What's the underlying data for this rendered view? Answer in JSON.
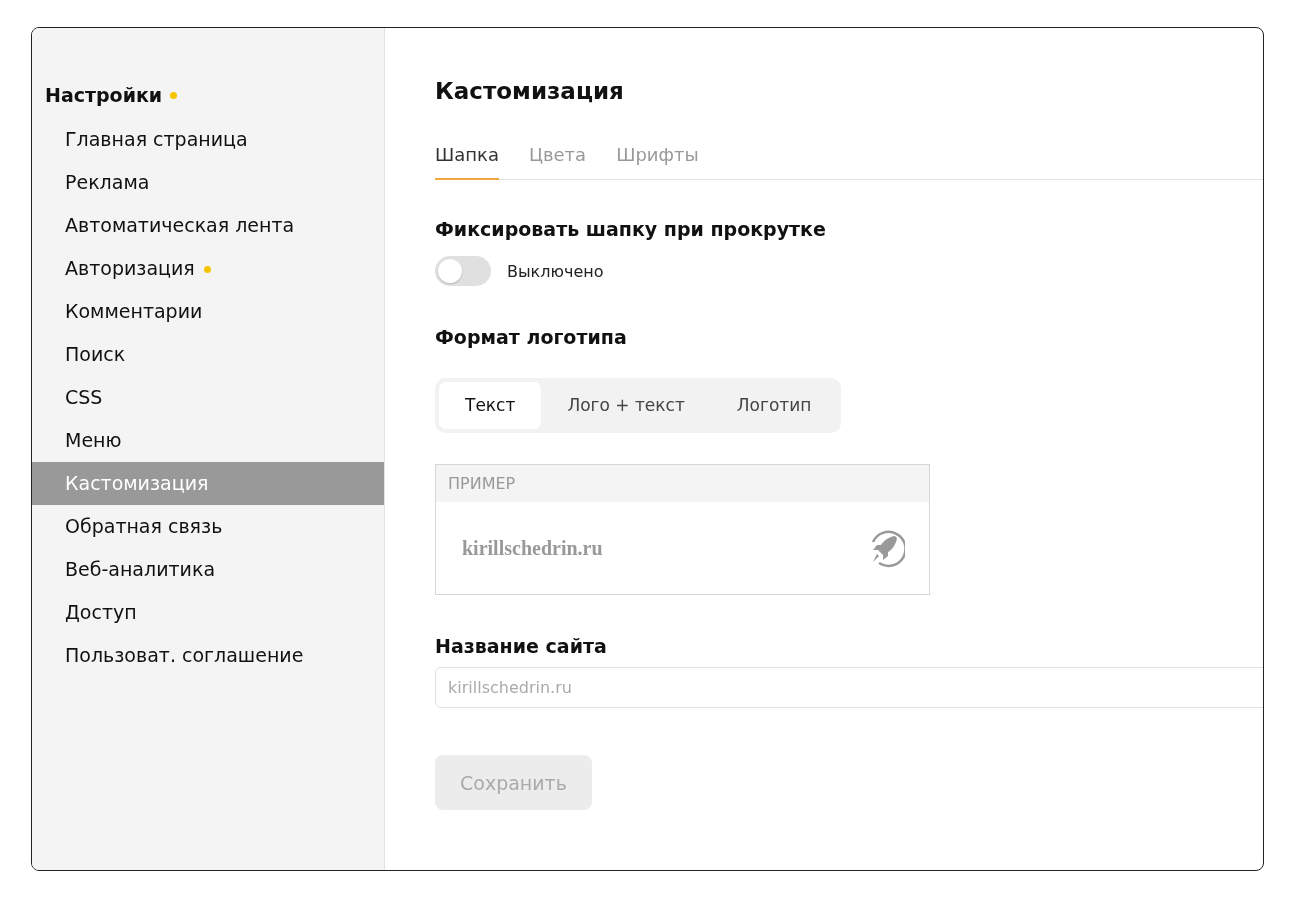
{
  "sidebar": {
    "title": "Настройки",
    "title_dot": true,
    "items": [
      {
        "label": "Главная страница",
        "selected": false,
        "dot": false
      },
      {
        "label": "Реклама",
        "selected": false,
        "dot": false
      },
      {
        "label": "Автоматическая лента",
        "selected": false,
        "dot": false
      },
      {
        "label": "Авторизация",
        "selected": false,
        "dot": true
      },
      {
        "label": "Комментарии",
        "selected": false,
        "dot": false
      },
      {
        "label": "Поиск",
        "selected": false,
        "dot": false
      },
      {
        "label": "CSS",
        "selected": false,
        "dot": false
      },
      {
        "label": "Меню",
        "selected": false,
        "dot": false
      },
      {
        "label": "Кастомизация",
        "selected": true,
        "dot": false
      },
      {
        "label": "Обратная связь",
        "selected": false,
        "dot": false
      },
      {
        "label": "Веб-аналитика",
        "selected": false,
        "dot": false
      },
      {
        "label": "Доступ",
        "selected": false,
        "dot": false
      },
      {
        "label": "Пользоват. соглашение",
        "selected": false,
        "dot": false
      }
    ]
  },
  "page_title": "Кастомизация",
  "tabs": [
    {
      "label": "Шапка",
      "selected": true
    },
    {
      "label": "Цвета",
      "selected": false
    },
    {
      "label": "Шрифты",
      "selected": false
    }
  ],
  "sticky_header": {
    "heading": "Фиксировать шапку при прокрутке",
    "on": false,
    "state_label": "Выключено"
  },
  "logo_format": {
    "heading": "Формат логотипа",
    "options": [
      {
        "label": "Текст",
        "selected": true
      },
      {
        "label": "Лого + текст",
        "selected": false
      },
      {
        "label": "Логотип",
        "selected": false
      }
    ]
  },
  "preview": {
    "caption": "ПРИМЕР",
    "site_text": "kirillschedrin.ru"
  },
  "site_name": {
    "heading": "Название сайта",
    "value": "kirillschedrin.ru"
  },
  "save_button": {
    "label": "Сохранить",
    "disabled": true
  }
}
